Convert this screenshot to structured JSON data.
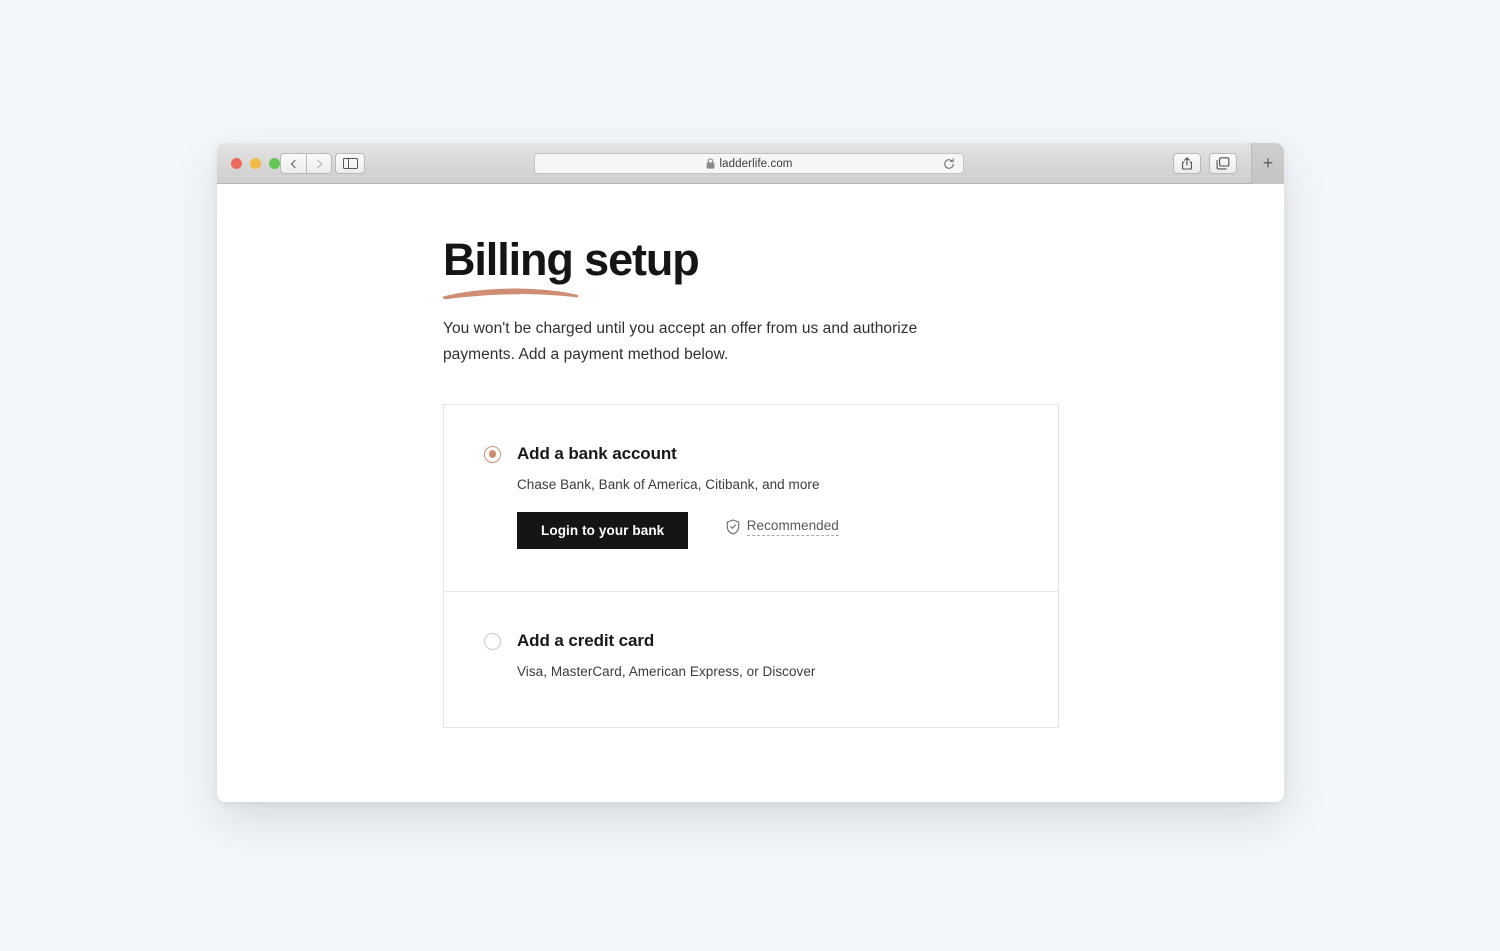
{
  "browser": {
    "traffic_lights": [
      "close",
      "minimize",
      "maximize"
    ],
    "back_label": "Back",
    "forward_label": "Forward",
    "sidebar_label": "Show Sidebar",
    "url": "ladderlife.com",
    "lock_icon": "lock-icon",
    "reload_icon": "reload-icon",
    "share_icon": "share-icon",
    "tabs_icon": "tab-overview-icon",
    "new_tab_label": "+",
    "colors": {
      "close": "#ef6a5e",
      "minimize": "#f2bb46",
      "maximize": "#63c755"
    }
  },
  "page": {
    "title": "Billing setup",
    "subtitle": "You won't be charged until you accept an offer from us and authorize payments. Add a payment method below.",
    "accent_color": "#cf8e73",
    "options": [
      {
        "id": "bank-account",
        "title": "Add a bank account",
        "description": "Chase Bank, Bank of America, Citibank, and more",
        "selected": true,
        "button_label": "Login to your bank",
        "badge_label": "Recommended",
        "badge_icon": "shield-check-icon"
      },
      {
        "id": "credit-card",
        "title": "Add a credit card",
        "description": "Visa, MasterCard, American Express, or Discover",
        "selected": false
      }
    ]
  }
}
